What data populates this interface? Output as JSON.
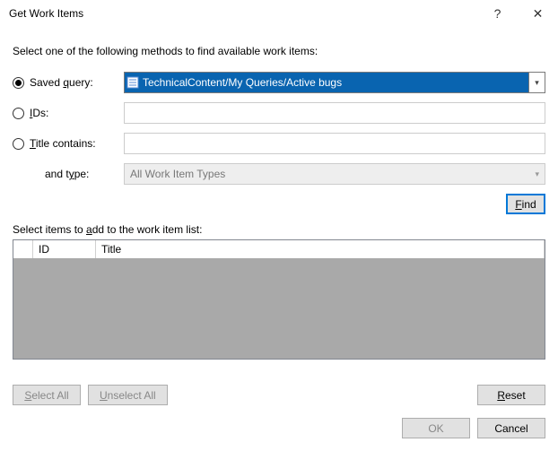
{
  "dialog": {
    "title": "Get Work Items",
    "help": "?",
    "close": "✕"
  },
  "instruction": "Select one of the following methods to find available work items:",
  "methods": {
    "savedQuery": {
      "prefix": "Saved ",
      "u": "q",
      "suffix": "uery:",
      "value": "TechnicalContent/My Queries/Active bugs"
    },
    "ids": {
      "u": "I",
      "suffix": "Ds:",
      "value": ""
    },
    "titleContains": {
      "u": "T",
      "suffix": "itle contains:",
      "value": ""
    },
    "andType": {
      "prefix": "and t",
      "u": "y",
      "suffix": "pe:",
      "value": "All Work Item Types"
    }
  },
  "buttons": {
    "find": {
      "prefix": "",
      "u": "F",
      "suffix": "ind"
    },
    "selectAll": {
      "u": "S",
      "suffix": "elect All"
    },
    "unselectAll": {
      "u": "U",
      "suffix": "nselect All"
    },
    "reset": {
      "u": "R",
      "suffix": "eset"
    },
    "ok": "OK",
    "cancel": "Cancel"
  },
  "selectInstruction": {
    "prefix": "Select items to ",
    "u": "a",
    "suffix": "dd to the work item list:"
  },
  "grid": {
    "columns": {
      "id": "ID",
      "title": "Title"
    },
    "rows": []
  }
}
